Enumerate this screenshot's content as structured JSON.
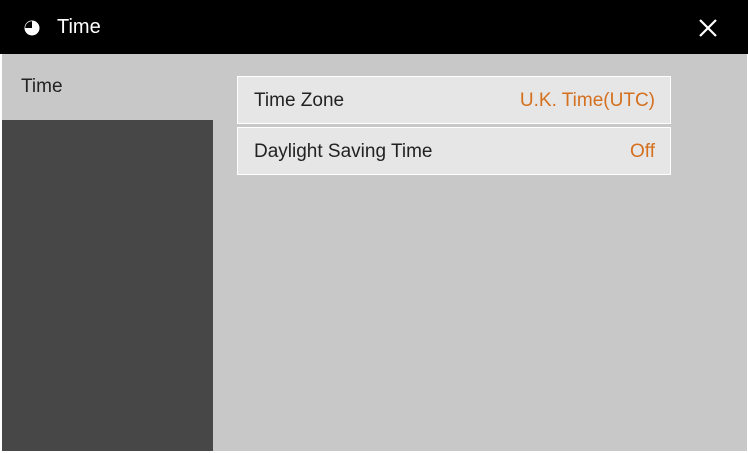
{
  "window": {
    "title": "Time",
    "title_icon": "clock-icon",
    "close_icon": "close-icon"
  },
  "sidebar": {
    "tabs": [
      {
        "label": "Time",
        "selected": true
      }
    ]
  },
  "settings": [
    {
      "label": "Time Zone",
      "value": "U.K. Time(UTC)"
    },
    {
      "label": "Daylight Saving Time",
      "value": "Off"
    }
  ],
  "colors": {
    "titlebar_bg": "#000000",
    "panel_bg": "#c8c8c8",
    "sidebar_bg": "#474747",
    "row_bg": "#e6e6e6",
    "value_accent": "#d4701e"
  }
}
